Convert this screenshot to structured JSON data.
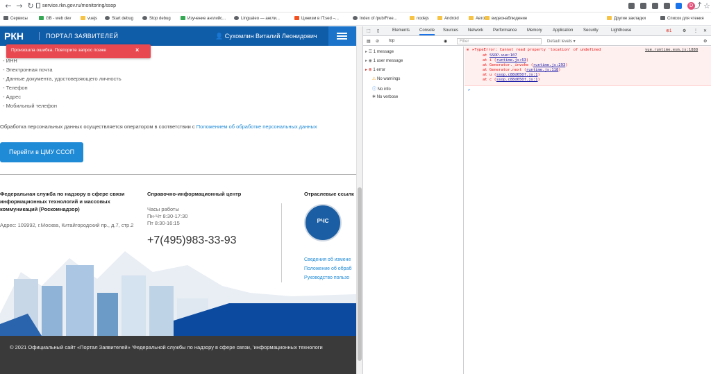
{
  "browser": {
    "url": "service.rkn.gov.ru/monitoring/ssop",
    "bookmarks": [
      "Сервисы",
      "GB - web dev",
      "vuejs",
      "Start debug",
      "Stop debug",
      "Изучение английс...",
      "Lingualeo — англи...",
      "Цинизм в IT:sed –...",
      "Index of /pub/Free...",
      "nodejs",
      "Android",
      "Авто",
      "видеонаблюдение"
    ],
    "other_bookmarks": "Другие закладки",
    "reading_list": "Список для чтения",
    "avatar_letter": "D"
  },
  "header": {
    "logo": "РКН",
    "portal": "ПОРТАЛ ЗАЯВИТЕЛЕЙ",
    "user": "Сухомлин Виталий Леонидович"
  },
  "error_toast": {
    "text": "Произошла ошибка. Повторите запрос позже",
    "close": "×"
  },
  "list": [
    "- ИНН",
    "- Электронная почта",
    "- Данные документа, удостоверяющего личность",
    "- Телефон",
    "- Адрес",
    "- Мобильный телефон"
  ],
  "note": {
    "text": "Обработка персональных данных осуществляется оператором в соответствии с ",
    "link": "Положением об обработке персональных данных"
  },
  "cta": "Перейти в ЦМУ ССОП",
  "footer": {
    "org_title": "Федеральная служба по надзору в сфере связи информационных технологий и массовых коммуникаций (Роскомнадзор)",
    "org_address": "Адрес: 109992, г.Москва, Китайгородский пр., д.7, стр.2",
    "center_title": "Справочно-информационный центр",
    "hours_label": "Часы работы",
    "hours_1": "Пн-Чт 8:30-17:30",
    "hours_2": "Пт 8:30-16:15",
    "phone": "+7(495)983-33-93",
    "links_title": "Отраслевые ссылк",
    "emblem": "РЧС",
    "links": [
      "Сведения об измене",
      "Положение об обраб",
      "Руководство пользо"
    ],
    "copyright": "© 2021 Официальный сайт «Портал Заявителей» 'Федеральной службы по надзору в сфере связи, 'информационных технологи"
  },
  "devtools": {
    "tabs": [
      "Elements",
      "Console",
      "Sources",
      "Network",
      "Performance",
      "Memory",
      "Application",
      "Security",
      "Lighthouse"
    ],
    "active_tab": "Console",
    "error_badge": "1",
    "context": "top",
    "filter_placeholder": "Filter",
    "levels": "Default levels ▾",
    "sidebar": [
      "1 message",
      "1 user message",
      "1 error",
      "No warnings",
      "No info",
      "No verbose"
    ],
    "error_line": "▸TypeError: Cannot read property 'location' of undefined",
    "error_source": "vue.runtime.esm.js:1888",
    "stack": [
      {
        "pre": "at ",
        "link": "SSOP.vue:107"
      },
      {
        "pre": "at i (",
        "link": "runtime.js:63",
        "post": ")"
      },
      {
        "pre": "at Generator._invoke (",
        "link": "runtime.js:293",
        "post": ")"
      },
      {
        "pre": "at Generator.next (",
        "link": "runtime.js:118",
        "post": ")"
      },
      {
        "pre": "at u (",
        "link": "ssop.c88d650f.js:1",
        "post": ")"
      },
      {
        "pre": "at c (",
        "link": "ssop.c88d650f.js:1",
        "post": ")"
      }
    ],
    "prompt": ">"
  }
}
